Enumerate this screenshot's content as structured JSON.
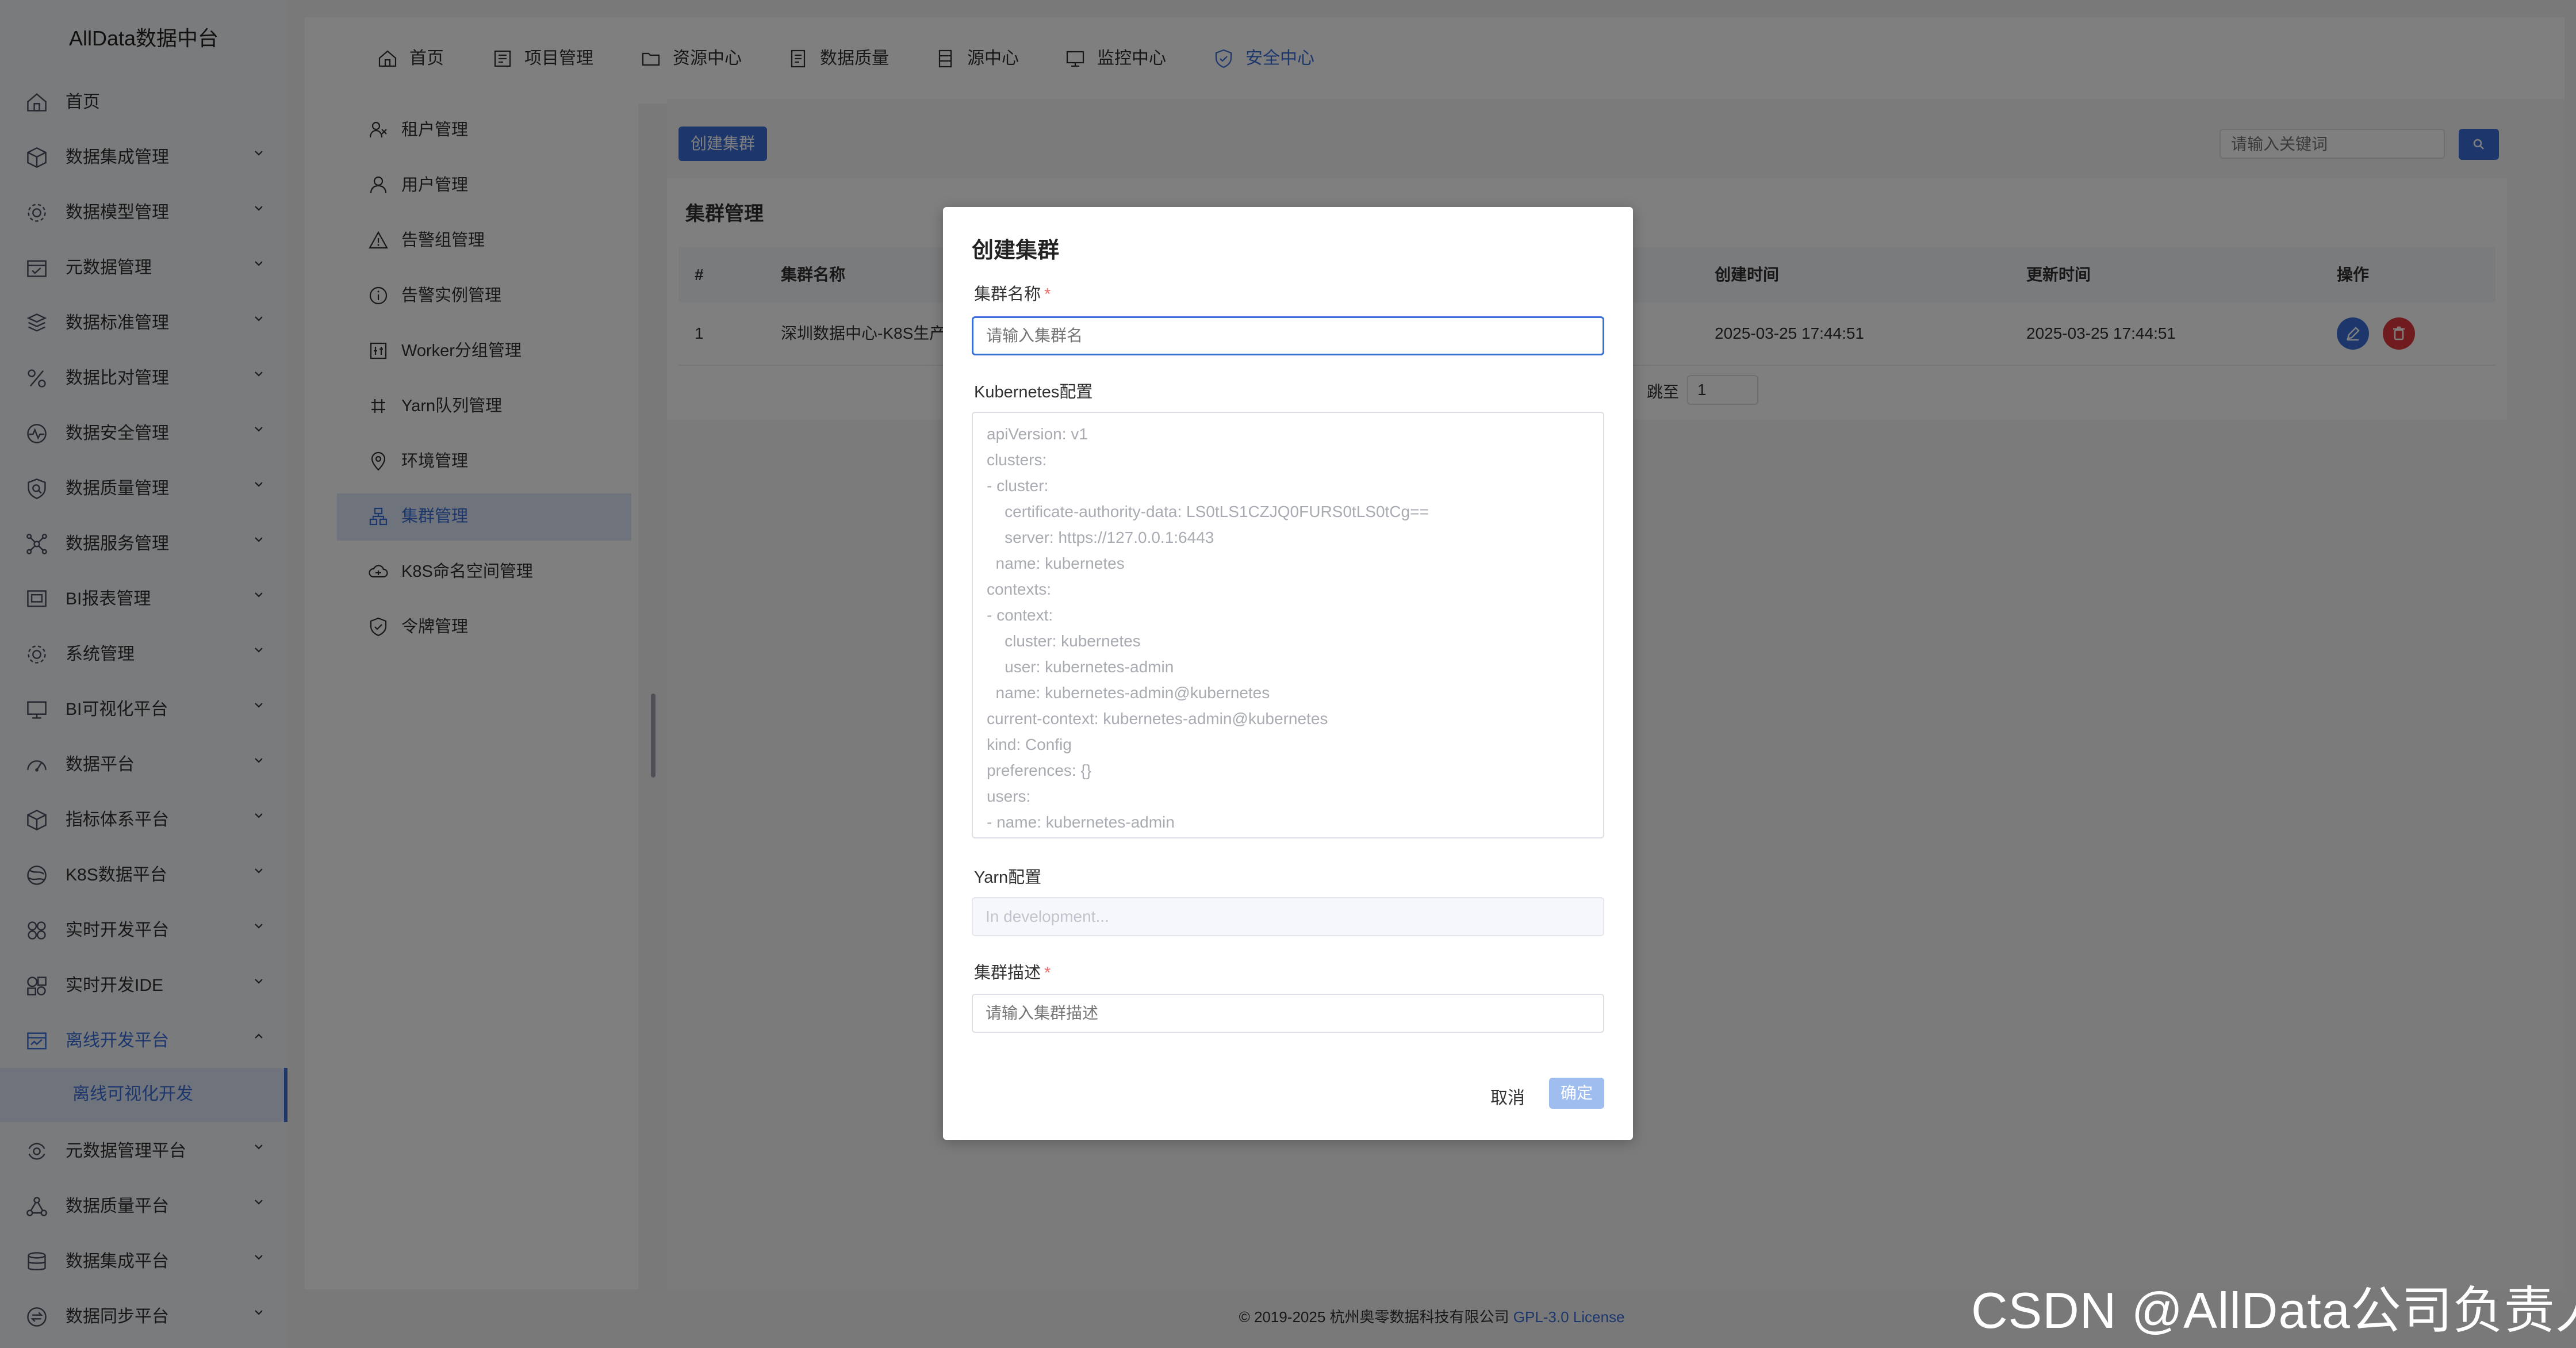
{
  "app": {
    "title": "AllData数据中台"
  },
  "sidebar": {
    "items": [
      {
        "label": "首页",
        "icon": "home-icon",
        "expandable": false
      },
      {
        "label": "数据集成管理",
        "icon": "cube-icon",
        "expandable": true
      },
      {
        "label": "数据模型管理",
        "icon": "gear-cog-icon",
        "expandable": true
      },
      {
        "label": "元数据管理",
        "icon": "calendar-icon",
        "expandable": true
      },
      {
        "label": "数据标准管理",
        "icon": "cube-stack-icon",
        "expandable": true
      },
      {
        "label": "数据比对管理",
        "icon": "percent-icon",
        "expandable": true
      },
      {
        "label": "数据安全管理",
        "icon": "pulse-shield-icon",
        "expandable": true
      },
      {
        "label": "数据质量管理",
        "icon": "magnifier-shield-icon",
        "expandable": true
      },
      {
        "label": "数据服务管理",
        "icon": "network-icon",
        "expandable": true
      },
      {
        "label": "BI报表管理",
        "icon": "report-icon",
        "expandable": true
      },
      {
        "label": "系统管理",
        "icon": "settings-icon",
        "expandable": true
      },
      {
        "label": "BI可视化平台",
        "icon": "monitor-icon",
        "expandable": true
      },
      {
        "label": "数据平台",
        "icon": "dashboard-icon",
        "expandable": true
      },
      {
        "label": "指标体系平台",
        "icon": "box-icon",
        "expandable": true
      },
      {
        "label": "K8S数据平台",
        "icon": "globe-icon",
        "expandable": true
      },
      {
        "label": "实时开发平台",
        "icon": "flower-icon",
        "expandable": true
      },
      {
        "label": "实时开发IDE",
        "icon": "ide-icon",
        "expandable": true
      },
      {
        "label": "离线开发平台",
        "icon": "offline-icon",
        "expandable": true,
        "expanded": true
      },
      {
        "label": "元数据管理平台",
        "icon": "refresh-gear-icon",
        "expandable": true
      },
      {
        "label": "数据质量平台",
        "icon": "nodes-icon",
        "expandable": true
      },
      {
        "label": "数据集成平台",
        "icon": "database-icon",
        "expandable": true
      },
      {
        "label": "数据同步平台",
        "icon": "sync-icon",
        "expandable": true
      }
    ],
    "sub_item": {
      "label": "离线可视化开发"
    }
  },
  "topnav": {
    "items": [
      {
        "label": "首页",
        "icon": "home-icon"
      },
      {
        "label": "项目管理",
        "icon": "project-icon"
      },
      {
        "label": "资源中心",
        "icon": "folder-icon"
      },
      {
        "label": "数据质量",
        "icon": "document-icon"
      },
      {
        "label": "源中心",
        "icon": "server-icon"
      },
      {
        "label": "监控中心",
        "icon": "monitor-icon"
      },
      {
        "label": "安全中心",
        "icon": "shield-check-icon",
        "active": true
      }
    ]
  },
  "subnav": {
    "items": [
      {
        "label": "租户管理",
        "icon": "tenant-icon"
      },
      {
        "label": "用户管理",
        "icon": "user-icon"
      },
      {
        "label": "告警组管理",
        "icon": "warning-icon"
      },
      {
        "label": "告警实例管理",
        "icon": "info-circle-icon"
      },
      {
        "label": "Worker分组管理",
        "icon": "worker-group-icon"
      },
      {
        "label": "Yarn队列管理",
        "icon": "yarn-icon"
      },
      {
        "label": "环境管理",
        "icon": "location-icon"
      },
      {
        "label": "集群管理",
        "icon": "cluster-icon",
        "active": true
      },
      {
        "label": "K8S命名空间管理",
        "icon": "cloud-icon"
      },
      {
        "label": "令牌管理",
        "icon": "token-shield-icon"
      }
    ]
  },
  "toolbar": {
    "create_label": "创建集群",
    "search_placeholder": "请输入关键词"
  },
  "cluster_panel": {
    "title": "集群管理",
    "columns": [
      "#",
      "集群名称",
      "创建时间",
      "更新时间",
      "操作"
    ],
    "rows": [
      {
        "index": "1",
        "name": "深圳数据中心-K8S生产",
        "created": "2025-03-25 17:44:51",
        "updated": "2025-03-25 17:44:51"
      }
    ],
    "pager": {
      "jump_label": "跳至",
      "page": "1"
    }
  },
  "dialog": {
    "title": "创建集群",
    "name_label": "集群名称",
    "name_placeholder": "请输入集群名",
    "k8s_label": "Kubernetes配置",
    "k8s_placeholder_lines": [
      "apiVersion: v1",
      "clusters:",
      "- cluster:",
      "    certificate-authority-data: LS0tLS1CZJQ0FURS0tLS0tCg==",
      "    server: https://127.0.0.1:6443",
      "  name: kubernetes",
      "contexts:",
      "- context:",
      "    cluster: kubernetes",
      "    user: kubernetes-admin",
      "  name: kubernetes-admin@kubernetes",
      "current-context: kubernetes-admin@kubernetes",
      "kind: Config",
      "preferences: {}",
      "users:",
      "- name: kubernetes-admin"
    ],
    "yarn_label": "Yarn配置",
    "yarn_placeholder": "In development...",
    "desc_label": "集群描述",
    "desc_placeholder": "请输入集群描述",
    "required_mark": "*",
    "cancel_label": "取消",
    "confirm_label": "确定"
  },
  "footer": {
    "copyright": "© 2019-2025 杭州奥零数据科技有限公司",
    "license": "GPL-3.0 License"
  },
  "watermark": {
    "text": "CSDN @AllData公司负责人"
  },
  "colors": {
    "primary": "#3a6fd8",
    "danger": "#e0393e",
    "required": "#f56c6c"
  }
}
